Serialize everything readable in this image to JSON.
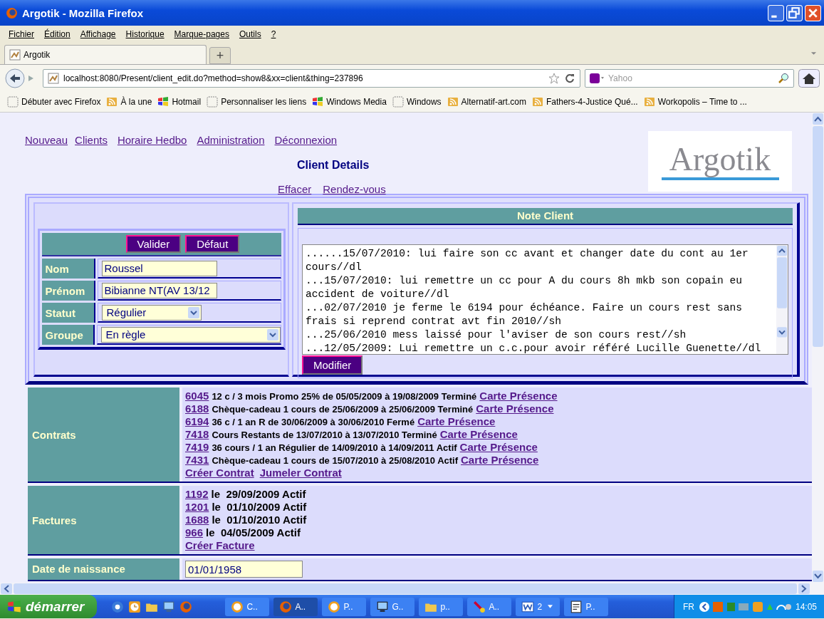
{
  "window": {
    "title": "Argotik - Mozilla Firefox"
  },
  "menu": [
    "Fichier",
    "Édition",
    "Affichage",
    "Historique",
    "Marque-pages",
    "Outils",
    "?"
  ],
  "tabs": [
    {
      "label": "Argotik",
      "selected": true
    }
  ],
  "new_tab": "+",
  "address_bar": {
    "url": "localhost:8080/Present/client_edit.do?method=show8&xx=client&thing=237896"
  },
  "search": {
    "placeholder": "Yahoo"
  },
  "bookmarks": [
    {
      "label": "Débuter avec Firefox",
      "kind": "page"
    },
    {
      "label": "À la une",
      "kind": "feed"
    },
    {
      "label": "Hotmail",
      "kind": "windows"
    },
    {
      "label": "Personnaliser les liens",
      "kind": "page"
    },
    {
      "label": "Windows Media",
      "kind": "windows"
    },
    {
      "label": "Windows",
      "kind": "page"
    },
    {
      "label": "Alternatif-art.com",
      "kind": "feed"
    },
    {
      "label": "Fathers-4-Justice Qué...",
      "kind": "feed"
    },
    {
      "label": "Workopolis – Time to ...",
      "kind": "feed"
    }
  ],
  "page": {
    "nav_links": [
      "Nouveau",
      "Clients",
      "Horaire Hedbo",
      "Administration",
      "Déconnexion"
    ],
    "title": "Client Details",
    "actions": [
      "Effacer",
      "Rendez-vous"
    ],
    "logo": "Argotik",
    "form": {
      "buttons": [
        "Valider",
        "Défaut"
      ],
      "fields": [
        {
          "label": "Nom",
          "value": "Roussel",
          "kind": "text"
        },
        {
          "label": "Prénom",
          "value": "Bibianne NT(AV 13/12",
          "kind": "text"
        },
        {
          "label": "Statut",
          "value": "Régulier",
          "kind": "select"
        },
        {
          "label": "Groupe",
          "value": "En règle",
          "kind": "select"
        }
      ]
    },
    "note": {
      "title": "Note Client",
      "button": "Modifier",
      "entries": [
        "......15/07/2010: lui faire son cc avant et changer date du cont au 1er cours//dl",
        "...15/07/2010: lui remettre un cc pour A du cours 8h mkb son copain eu accident de voiture//dl",
        "...02/07/2010 je ferme le 6194 pour échéance. Faire un cours rest sans frais si reprend contrat avt fin 2010//sh",
        "...25/06/2010 mess laissé pour l'aviser de son cours rest//sh",
        "...12/05/2009: Lui remettre un c.c.pour avoir référé Lucille Guenette//dl"
      ]
    },
    "contracts": {
      "label": "Contrats",
      "rows": [
        {
          "id": "6045",
          "text": "12 c / 3 mois Promo 25% de 05/05/2009 à 19/08/2009 Terminé",
          "link": "Carte Présence"
        },
        {
          "id": "6188",
          "text": "Chèque-cadeau 1 cours de 25/06/2009 à 25/06/2009 Terminé",
          "link": "Carte Présence"
        },
        {
          "id": "6194",
          "text": "36 c / 1 an R de 30/06/2009 à 30/06/2010 Fermé",
          "link": "Carte Présence"
        },
        {
          "id": "7418",
          "text": "Cours Restants de 13/07/2010 à 13/07/2010 Terminé",
          "link": "Carte Présence"
        },
        {
          "id": "7419",
          "text": "36 cours / 1 an Régulier de 14/09/2010 à 14/09/2011 Actif",
          "link": "Carte Présence"
        },
        {
          "id": "7431",
          "text": "Chèque-cadeau 1 cours de 15/07/2010 à 25/08/2010 Actif",
          "link": "Carte Présence"
        }
      ],
      "links": [
        "Créer Contrat",
        "Jumeler Contrat"
      ]
    },
    "invoices": {
      "label": "Factures",
      "rows": [
        {
          "id": "1192",
          "text": "le  29/09/2009 Actif"
        },
        {
          "id": "1201",
          "text": "le  01/10/2009 Actif"
        },
        {
          "id": "1688",
          "text": "le  01/10/2010 Actif"
        },
        {
          "id": "966",
          "text": "le  04/05/2009 Actif"
        }
      ],
      "link": "Créer Facture"
    },
    "birth_date": {
      "label": "Date de naissance",
      "value": "01/01/1958"
    }
  },
  "taskbar": {
    "start": "démarrer",
    "tasks": [
      {
        "label": "C..",
        "kind": "clock",
        "selected": false
      },
      {
        "label": "A..",
        "kind": "firefox",
        "selected": true
      },
      {
        "label": "P..",
        "kind": "clock",
        "selected": false
      },
      {
        "label": "G..",
        "kind": "computer",
        "selected": false
      },
      {
        "label": "p..",
        "kind": "folder",
        "selected": false
      },
      {
        "label": "A..",
        "kind": "tool",
        "selected": false
      },
      {
        "label": "2",
        "kind": "word",
        "selected": false
      },
      {
        "label": "P..",
        "kind": "doc",
        "selected": false
      }
    ],
    "language": "FR",
    "time": "14:05"
  }
}
